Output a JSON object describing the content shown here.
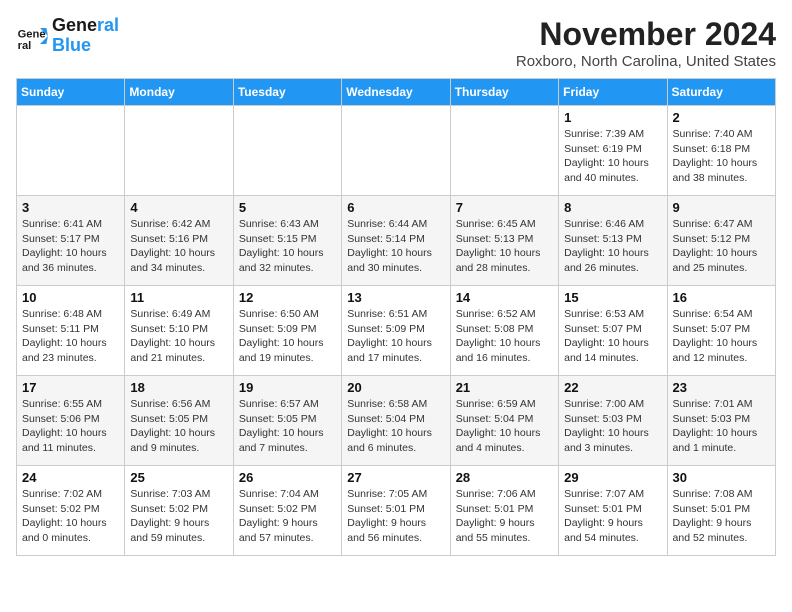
{
  "logo": {
    "text1": "General",
    "text2": "Blue"
  },
  "title": "November 2024",
  "location": "Roxboro, North Carolina, United States",
  "days_header": [
    "Sunday",
    "Monday",
    "Tuesday",
    "Wednesday",
    "Thursday",
    "Friday",
    "Saturday"
  ],
  "weeks": [
    [
      {
        "day": "",
        "info": ""
      },
      {
        "day": "",
        "info": ""
      },
      {
        "day": "",
        "info": ""
      },
      {
        "day": "",
        "info": ""
      },
      {
        "day": "",
        "info": ""
      },
      {
        "day": "1",
        "info": "Sunrise: 7:39 AM\nSunset: 6:19 PM\nDaylight: 10 hours and 40 minutes."
      },
      {
        "day": "2",
        "info": "Sunrise: 7:40 AM\nSunset: 6:18 PM\nDaylight: 10 hours and 38 minutes."
      }
    ],
    [
      {
        "day": "3",
        "info": "Sunrise: 6:41 AM\nSunset: 5:17 PM\nDaylight: 10 hours and 36 minutes."
      },
      {
        "day": "4",
        "info": "Sunrise: 6:42 AM\nSunset: 5:16 PM\nDaylight: 10 hours and 34 minutes."
      },
      {
        "day": "5",
        "info": "Sunrise: 6:43 AM\nSunset: 5:15 PM\nDaylight: 10 hours and 32 minutes."
      },
      {
        "day": "6",
        "info": "Sunrise: 6:44 AM\nSunset: 5:14 PM\nDaylight: 10 hours and 30 minutes."
      },
      {
        "day": "7",
        "info": "Sunrise: 6:45 AM\nSunset: 5:13 PM\nDaylight: 10 hours and 28 minutes."
      },
      {
        "day": "8",
        "info": "Sunrise: 6:46 AM\nSunset: 5:13 PM\nDaylight: 10 hours and 26 minutes."
      },
      {
        "day": "9",
        "info": "Sunrise: 6:47 AM\nSunset: 5:12 PM\nDaylight: 10 hours and 25 minutes."
      }
    ],
    [
      {
        "day": "10",
        "info": "Sunrise: 6:48 AM\nSunset: 5:11 PM\nDaylight: 10 hours and 23 minutes."
      },
      {
        "day": "11",
        "info": "Sunrise: 6:49 AM\nSunset: 5:10 PM\nDaylight: 10 hours and 21 minutes."
      },
      {
        "day": "12",
        "info": "Sunrise: 6:50 AM\nSunset: 5:09 PM\nDaylight: 10 hours and 19 minutes."
      },
      {
        "day": "13",
        "info": "Sunrise: 6:51 AM\nSunset: 5:09 PM\nDaylight: 10 hours and 17 minutes."
      },
      {
        "day": "14",
        "info": "Sunrise: 6:52 AM\nSunset: 5:08 PM\nDaylight: 10 hours and 16 minutes."
      },
      {
        "day": "15",
        "info": "Sunrise: 6:53 AM\nSunset: 5:07 PM\nDaylight: 10 hours and 14 minutes."
      },
      {
        "day": "16",
        "info": "Sunrise: 6:54 AM\nSunset: 5:07 PM\nDaylight: 10 hours and 12 minutes."
      }
    ],
    [
      {
        "day": "17",
        "info": "Sunrise: 6:55 AM\nSunset: 5:06 PM\nDaylight: 10 hours and 11 minutes."
      },
      {
        "day": "18",
        "info": "Sunrise: 6:56 AM\nSunset: 5:05 PM\nDaylight: 10 hours and 9 minutes."
      },
      {
        "day": "19",
        "info": "Sunrise: 6:57 AM\nSunset: 5:05 PM\nDaylight: 10 hours and 7 minutes."
      },
      {
        "day": "20",
        "info": "Sunrise: 6:58 AM\nSunset: 5:04 PM\nDaylight: 10 hours and 6 minutes."
      },
      {
        "day": "21",
        "info": "Sunrise: 6:59 AM\nSunset: 5:04 PM\nDaylight: 10 hours and 4 minutes."
      },
      {
        "day": "22",
        "info": "Sunrise: 7:00 AM\nSunset: 5:03 PM\nDaylight: 10 hours and 3 minutes."
      },
      {
        "day": "23",
        "info": "Sunrise: 7:01 AM\nSunset: 5:03 PM\nDaylight: 10 hours and 1 minute."
      }
    ],
    [
      {
        "day": "24",
        "info": "Sunrise: 7:02 AM\nSunset: 5:02 PM\nDaylight: 10 hours and 0 minutes."
      },
      {
        "day": "25",
        "info": "Sunrise: 7:03 AM\nSunset: 5:02 PM\nDaylight: 9 hours and 59 minutes."
      },
      {
        "day": "26",
        "info": "Sunrise: 7:04 AM\nSunset: 5:02 PM\nDaylight: 9 hours and 57 minutes."
      },
      {
        "day": "27",
        "info": "Sunrise: 7:05 AM\nSunset: 5:01 PM\nDaylight: 9 hours and 56 minutes."
      },
      {
        "day": "28",
        "info": "Sunrise: 7:06 AM\nSunset: 5:01 PM\nDaylight: 9 hours and 55 minutes."
      },
      {
        "day": "29",
        "info": "Sunrise: 7:07 AM\nSunset: 5:01 PM\nDaylight: 9 hours and 54 minutes."
      },
      {
        "day": "30",
        "info": "Sunrise: 7:08 AM\nSunset: 5:01 PM\nDaylight: 9 hours and 52 minutes."
      }
    ]
  ]
}
